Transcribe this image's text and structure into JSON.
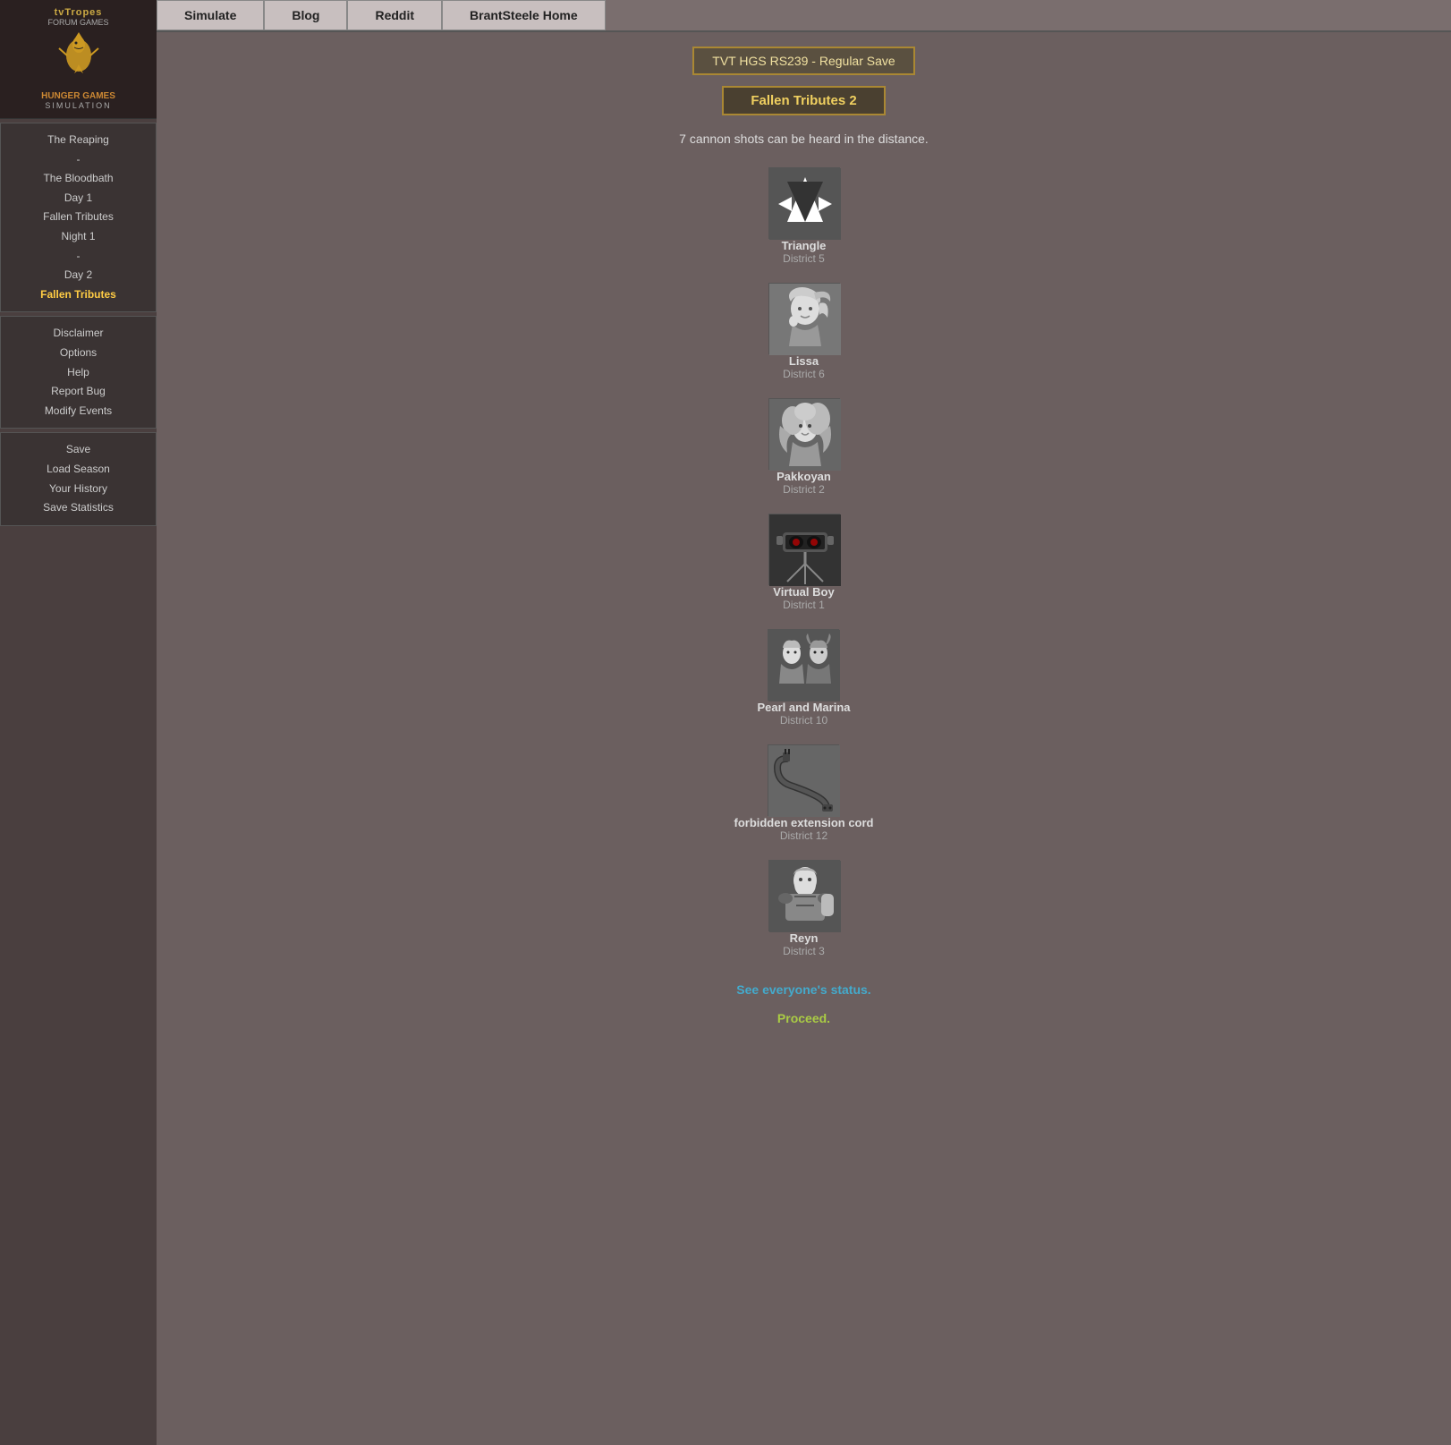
{
  "logo": {
    "tv_tropes": "tvTropes",
    "forum_games": "FORUM GAMES",
    "hunger_games": "HUNGER GAMES",
    "simulation": "SIMULATION"
  },
  "nav": {
    "items": [
      {
        "label": "The Reaping",
        "active": false,
        "id": "the-reaping"
      },
      {
        "label": "-",
        "separator": true
      },
      {
        "label": "The Bloodbath",
        "active": false,
        "id": "bloodbath"
      },
      {
        "label": "Day 1",
        "active": false,
        "id": "day-1"
      },
      {
        "label": "Fallen Tributes",
        "active": false,
        "id": "fallen-tributes-1"
      },
      {
        "label": "Night 1",
        "active": false,
        "id": "night-1"
      },
      {
        "label": "-",
        "separator": true
      },
      {
        "label": "Day 2",
        "active": false,
        "id": "day-2"
      },
      {
        "label": "Fallen Tributes",
        "active": true,
        "id": "fallen-tributes-2"
      }
    ]
  },
  "utility": {
    "items": [
      {
        "label": "Disclaimer",
        "id": "disclaimer"
      },
      {
        "label": "Options",
        "id": "options"
      },
      {
        "label": "Help",
        "id": "help"
      },
      {
        "label": "Report Bug",
        "id": "report-bug"
      },
      {
        "label": "Modify Events",
        "id": "modify-events"
      }
    ]
  },
  "save": {
    "items": [
      {
        "label": "Save",
        "id": "save"
      },
      {
        "label": "Load Season",
        "id": "load-season"
      },
      {
        "label": "Your History",
        "id": "your-history"
      },
      {
        "label": "Save Statistics",
        "id": "save-statistics"
      }
    ]
  },
  "top_nav": {
    "buttons": [
      {
        "label": "Simulate",
        "id": "simulate"
      },
      {
        "label": "Blog",
        "id": "blog"
      },
      {
        "label": "Reddit",
        "id": "reddit"
      },
      {
        "label": "BrantSteele Home",
        "id": "brantsteele-home"
      }
    ]
  },
  "content": {
    "save_title": "TVT HGS RS239 - Regular Save",
    "section_title": "Fallen Tributes 2",
    "cannon_text": "7 cannon shots can be heard in the distance.",
    "tributes": [
      {
        "name": "Triangle",
        "district": "District 5",
        "color": "#444"
      },
      {
        "name": "Lissa",
        "district": "District 6",
        "color": "#888"
      },
      {
        "name": "Pakkoyan",
        "district": "District 2",
        "color": "#777"
      },
      {
        "name": "Virtual Boy",
        "district": "District 1",
        "color": "#333"
      },
      {
        "name": "Pearl and Marina",
        "district": "District 10",
        "color": "#555"
      },
      {
        "name": "forbidden extension cord",
        "district": "District 12",
        "color": "#666"
      },
      {
        "name": "Reyn",
        "district": "District 3",
        "color": "#555"
      }
    ],
    "see_status_link": "See everyone's status.",
    "proceed_link": "Proceed."
  }
}
